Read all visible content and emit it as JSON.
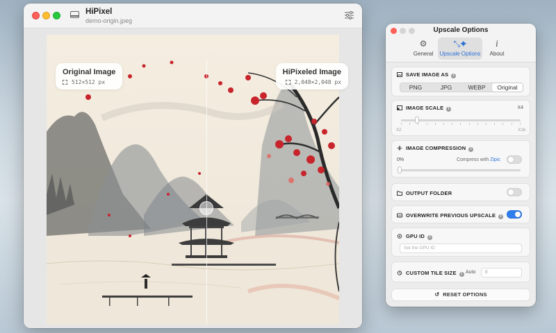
{
  "main_window": {
    "app_name": "HiPixel",
    "file_name": "demo-origin.jpeg"
  },
  "comparison": {
    "original": {
      "title": "Original Image",
      "size": "512×512 px"
    },
    "hipixeled": {
      "title": "HiPixeled Image",
      "size": "2,048×2,048 px"
    }
  },
  "options_window": {
    "title": "Upscale Options",
    "tabs": [
      {
        "label": "General",
        "icon": "gear-icon"
      },
      {
        "label": "Upscale Options",
        "icon": "sparkles-icon",
        "selected": true
      },
      {
        "label": "About",
        "icon": "info-icon"
      }
    ],
    "save_image_as": {
      "label": "SAVE IMAGE AS",
      "formats": [
        "PNG",
        "JPG",
        "WEBP",
        "Original"
      ],
      "selected": "Original"
    },
    "image_scale": {
      "label": "IMAGE SCALE",
      "value": "X4",
      "min_label": "X2",
      "max_label": "X16"
    },
    "image_compression": {
      "label": "IMAGE COMPRESSION",
      "value": "0%",
      "compress_prefix": "Compress with",
      "compress_link": "Zipic",
      "compress_enabled": false
    },
    "output_folder": {
      "label": "OUTPUT FOLDER",
      "enabled": false
    },
    "overwrite_previous": {
      "label": "OVERWRITE PREVIOUS UPSCALE",
      "enabled": true
    },
    "gpu_id": {
      "label": "GPU ID",
      "placeholder": "Set the GPU ID"
    },
    "custom_tile_size": {
      "label": "CUSTOM TILE SIZE",
      "mode": "Auto",
      "value": "0"
    },
    "reset_label": "RESET OPTIONS"
  },
  "colors": {
    "accent": "#2f7ef0",
    "close": "#fe5f57",
    "minimize": "#febc2e",
    "zoom": "#28c840",
    "maple_red": "#c8242b"
  }
}
